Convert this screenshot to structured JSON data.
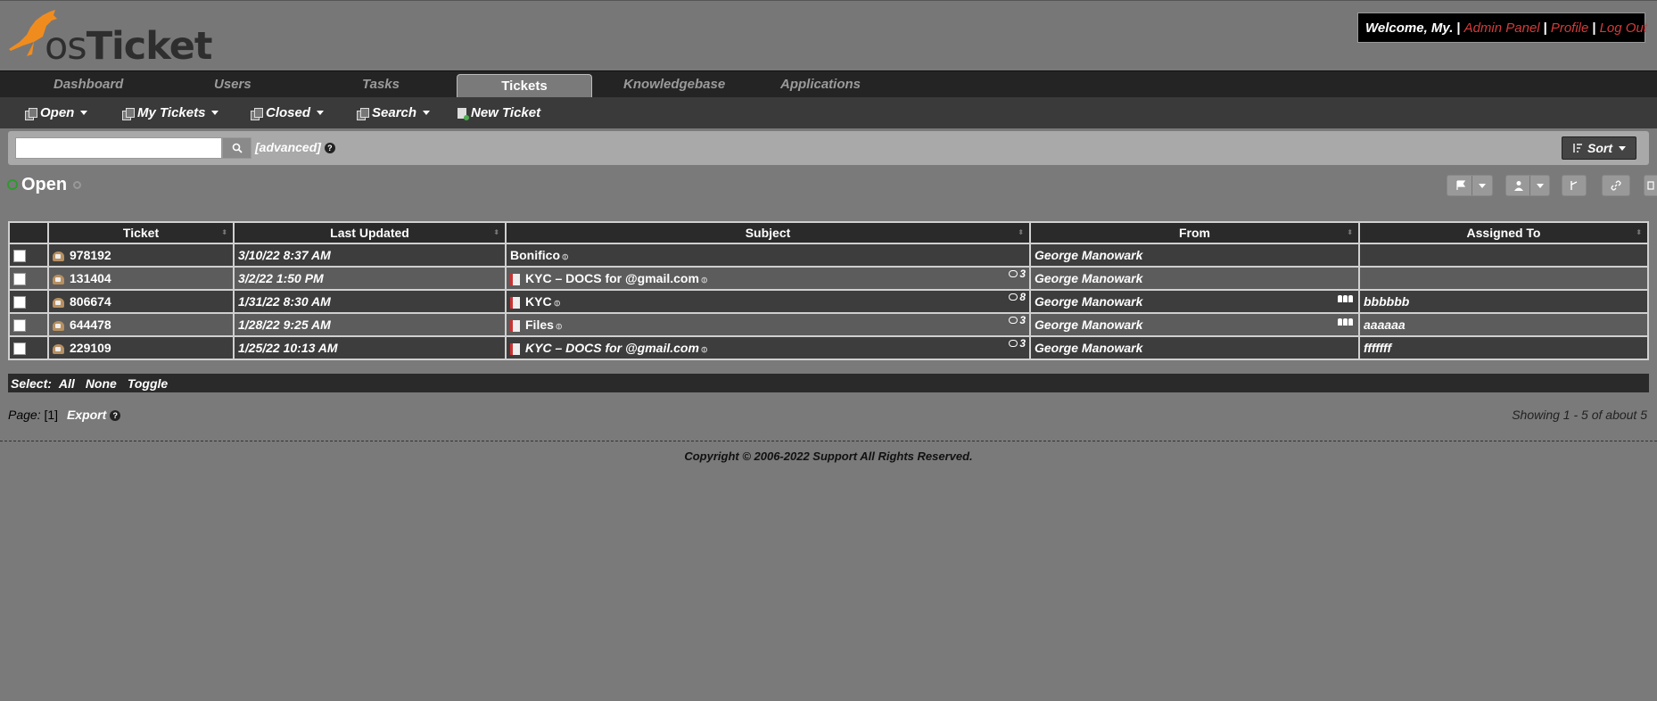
{
  "app": {
    "logo_os": "os",
    "logo_ticket": "Ticket"
  },
  "welcome": {
    "greeting": "Welcome, My.",
    "sep": "|",
    "admin": "Admin Panel",
    "profile": "Profile",
    "logout": "Log Out"
  },
  "nav": [
    {
      "label": "Dashboard"
    },
    {
      "label": "Users"
    },
    {
      "label": "Tasks"
    },
    {
      "label": "Tickets"
    },
    {
      "label": "Knowledgebase"
    },
    {
      "label": "Applications"
    }
  ],
  "subnav": {
    "open": "Open",
    "my_tickets": "My Tickets",
    "closed": "Closed",
    "search": "Search",
    "new_ticket": "New Ticket"
  },
  "search": {
    "placeholder": "",
    "value": "",
    "advanced": "[advanced]",
    "help": "?",
    "sort": "Sort"
  },
  "queue": {
    "title": "Open"
  },
  "table": {
    "headers": [
      "Ticket",
      "Last Updated",
      "Subject",
      "From",
      "Assigned To"
    ],
    "rows": [
      {
        "number": "978192",
        "updated": "3/10/22 8:37 AM",
        "subject": "Bonifico",
        "threads": "",
        "from": "George Manowark",
        "assigned": ""
      },
      {
        "number": "131404",
        "updated": "3/2/22 1:50 PM",
        "subject": "KYC – DOCS for @gmail.com",
        "threads": "3",
        "from": "George Manowark",
        "assigned": ""
      },
      {
        "number": "806674",
        "updated": "1/31/22 8:30 AM",
        "subject": "KYC",
        "threads": "8",
        "from": "George Manowark",
        "assigned": "bbbbbb"
      },
      {
        "number": "644478",
        "updated": "1/28/22 9:25 AM",
        "subject": "Files",
        "threads": "3",
        "from": "George Manowark",
        "assigned": "aaaaaa"
      },
      {
        "number": "229109",
        "updated": "1/25/22 10:13 AM",
        "subject": "KYC – DOCS for @gmail.com",
        "threads": "3",
        "from": "George Manowark",
        "assigned": "fffffff"
      }
    ]
  },
  "select": {
    "label": "Select:",
    "all": "All",
    "none": "None",
    "toggle": "Toggle"
  },
  "pager": {
    "label": "Page:",
    "current": "[1]",
    "export": "Export",
    "showing": "Showing 1 - 5 of about 5"
  },
  "footer": {
    "copyright": "Copyright © 2006-2022  Support All Rights Reserved."
  }
}
